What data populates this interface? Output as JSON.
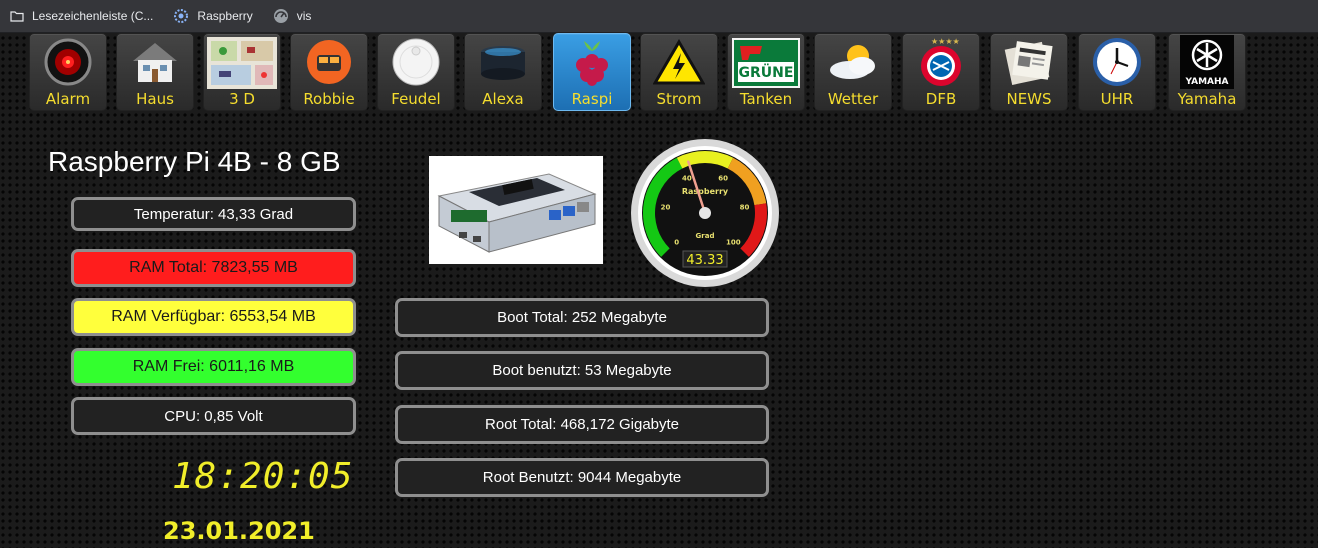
{
  "bookmarks": [
    {
      "label": "Lesezeichenleiste (C...",
      "icon": "folder-icon"
    },
    {
      "label": "Raspberry",
      "icon": "gear-icon"
    },
    {
      "label": "vis",
      "icon": "vis-icon"
    }
  ],
  "nav": [
    {
      "label": "Alarm",
      "icon": "hal-eye-icon"
    },
    {
      "label": "Haus",
      "icon": "house-icon"
    },
    {
      "label": "3 D",
      "icon": "floorplan-icon"
    },
    {
      "label": "Robbie",
      "icon": "robot-icon"
    },
    {
      "label": "Feudel",
      "icon": "vacuum-icon"
    },
    {
      "label": "Alexa",
      "icon": "echo-icon"
    },
    {
      "label": "Raspi",
      "icon": "raspberry-icon",
      "active": true
    },
    {
      "label": "Strom",
      "icon": "warning-bolt-icon"
    },
    {
      "label": "Tanken",
      "icon": "gas-station-icon",
      "sign_text": "GRÜNE"
    },
    {
      "label": "Wetter",
      "icon": "weather-icon"
    },
    {
      "label": "DFB",
      "icon": "fc-bayern-icon"
    },
    {
      "label": "NEWS",
      "icon": "newspaper-icon"
    },
    {
      "label": "UHR",
      "icon": "clock-icon"
    },
    {
      "label": "Yamaha",
      "icon": "yamaha-icon",
      "logo_text": "YAMAHA"
    }
  ],
  "main": {
    "title": "Raspberry Pi 4B - 8 GB",
    "temperature": "Temperatur: 43,33 Grad",
    "ram_total": "RAM Total: 7823,55 MB",
    "ram_available": "RAM Verfügbar: 6553,54 MB",
    "ram_free": "RAM Frei: 6011,16 MB",
    "cpu": "CPU: 0,85 Volt",
    "time": "18:20:05",
    "date": "23.01.2021",
    "boot_total": "Boot Total: 252 Megabyte",
    "boot_used": "Boot benutzt: 53 Megabyte",
    "root_total": "Root Total: 468,172 Gigabyte",
    "root_used": "Root Benutzt: 9044 Megabyte"
  },
  "gauge": {
    "title": "Raspberry",
    "unit": "Grad",
    "value": 43.33,
    "value_text": "43.33",
    "min": 0,
    "max": 100,
    "ticks": [
      "0",
      "20",
      "40",
      "60",
      "80",
      "100"
    ],
    "zones": [
      {
        "from": 0,
        "to": 40,
        "color": "#14c814"
      },
      {
        "from": 40,
        "to": 60,
        "color": "#e8f020"
      },
      {
        "from": 60,
        "to": 80,
        "color": "#f0a020"
      },
      {
        "from": 80,
        "to": 100,
        "color": "#e01818"
      }
    ]
  },
  "colors": {
    "accent_yellow": "#f5dd2e",
    "active_tab": "#2a86cf",
    "ram_total_bg": "#ff1d1d",
    "ram_available_bg": "#ffff3c",
    "ram_free_bg": "#33ff2e"
  }
}
